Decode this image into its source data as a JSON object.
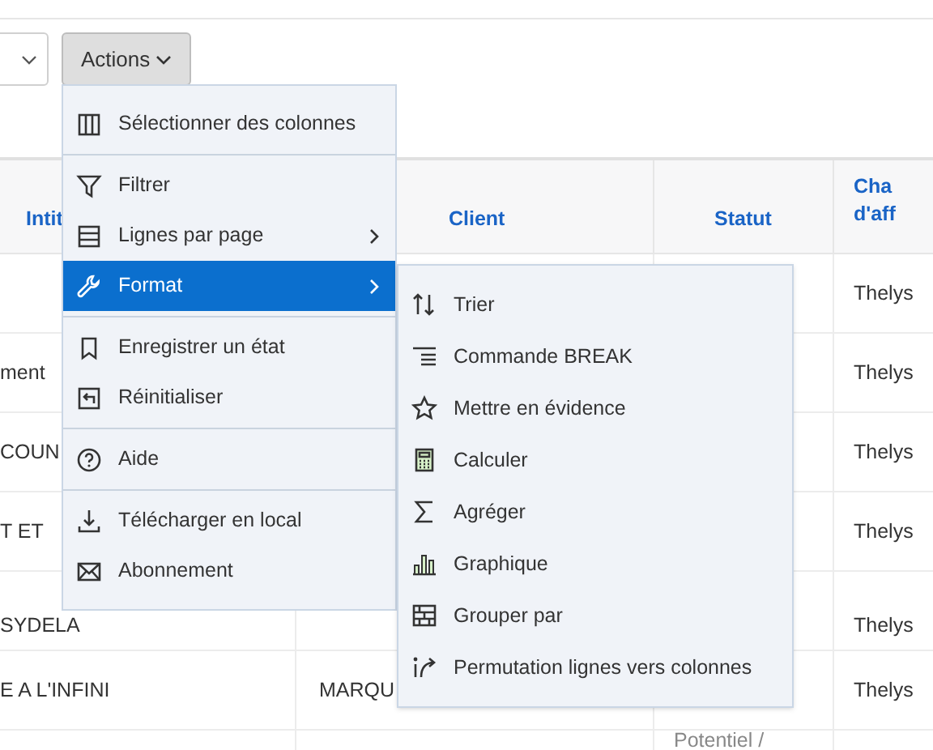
{
  "toolbar": {
    "actions_button": {
      "label": "Actions"
    }
  },
  "table": {
    "columns": [
      {
        "label": "Intit"
      },
      {
        "label": "Client"
      },
      {
        "label": "Statut"
      },
      {
        "label": "Cha\nd'aff"
      }
    ],
    "rows": [
      {
        "charge": "Thelys"
      },
      {
        "intitule": "ment",
        "charge": "Thelys"
      },
      {
        "intitule": "COUN",
        "charge": "Thelys"
      },
      {
        "intitule": "T ET",
        "charge": "Thelys"
      },
      {
        "intitule": "SYDELA",
        "charge": "Thelys"
      },
      {
        "intitule": "E A L'INFINI",
        "client": "MARQU",
        "charge": "Thelys"
      },
      {
        "statut": "Potentiel /"
      }
    ]
  },
  "actions_menu": {
    "groups": [
      [
        {
          "label": "Sélectionner des colonnes",
          "has_submenu": false,
          "selected": false
        }
      ],
      [
        {
          "label": "Filtrer",
          "has_submenu": false,
          "selected": false
        },
        {
          "label": "Lignes par page",
          "has_submenu": true,
          "selected": false
        },
        {
          "label": "Format",
          "has_submenu": true,
          "selected": true
        }
      ],
      [
        {
          "label": "Enregistrer un état",
          "has_submenu": false,
          "selected": false
        },
        {
          "label": "Réinitialiser",
          "has_submenu": false,
          "selected": false
        }
      ],
      [
        {
          "label": "Aide",
          "has_submenu": false,
          "selected": false
        }
      ],
      [
        {
          "label": "Télécharger en local",
          "has_submenu": false,
          "selected": false
        },
        {
          "label": "Abonnement",
          "has_submenu": false,
          "selected": false
        }
      ]
    ]
  },
  "format_submenu": {
    "items": [
      {
        "label": "Trier"
      },
      {
        "label": "Commande BREAK"
      },
      {
        "label": "Mettre en évidence"
      },
      {
        "label": "Calculer"
      },
      {
        "label": "Agréger"
      },
      {
        "label": "Graphique"
      },
      {
        "label": "Grouper par"
      },
      {
        "label": "Permutation lignes vers colonnes"
      }
    ]
  }
}
